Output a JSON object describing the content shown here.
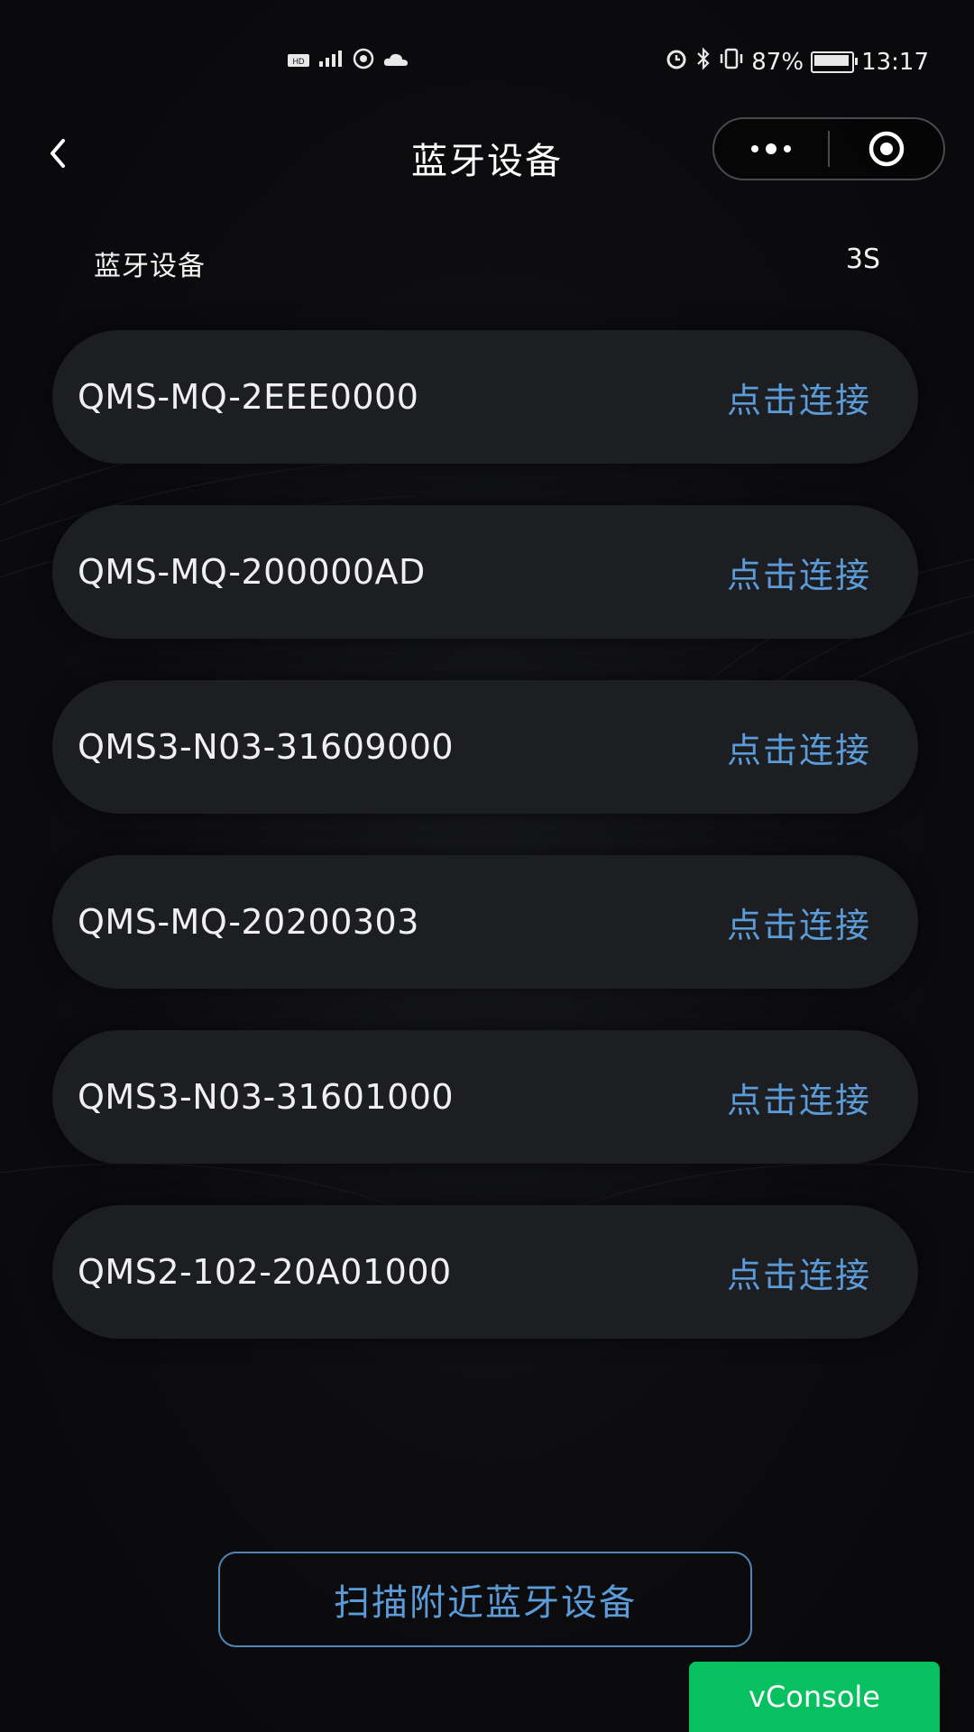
{
  "status_bar": {
    "left_icons": [
      "hd-icon",
      "signal-icon",
      "hotspot-icon",
      "cloud-icon"
    ],
    "right_icons": [
      "alarm-icon",
      "bluetooth-icon",
      "vibrate-icon"
    ],
    "battery_percent": "87%",
    "battery_level": 0.87,
    "time": "13:17"
  },
  "nav": {
    "title": "蓝牙设备",
    "back_icon": "chevron-left-icon",
    "more_icon": "more-dots-icon",
    "close_icon": "target-circle-icon"
  },
  "header": {
    "label": "蓝牙设备",
    "countdown": "3S"
  },
  "devices": [
    {
      "name": "QMS-MQ-2EEE0000",
      "action": "点击连接"
    },
    {
      "name": "QMS-MQ-200000AD",
      "action": "点击连接"
    },
    {
      "name": "QMS3-N03-31609000",
      "action": "点击连接"
    },
    {
      "name": "QMS-MQ-20200303",
      "action": "点击连接"
    },
    {
      "name": "QMS3-N03-31601000",
      "action": "点击连接"
    },
    {
      "name": "QMS2-102-20A01000",
      "action": "点击连接"
    }
  ],
  "scan_button": {
    "label": "扫描附近蓝牙设备"
  },
  "vconsole": {
    "label": "vConsole",
    "color": "#07c160"
  },
  "colors": {
    "accent": "#5b9bd8",
    "card": "#1d1e22",
    "background": "#0b0b0d"
  }
}
